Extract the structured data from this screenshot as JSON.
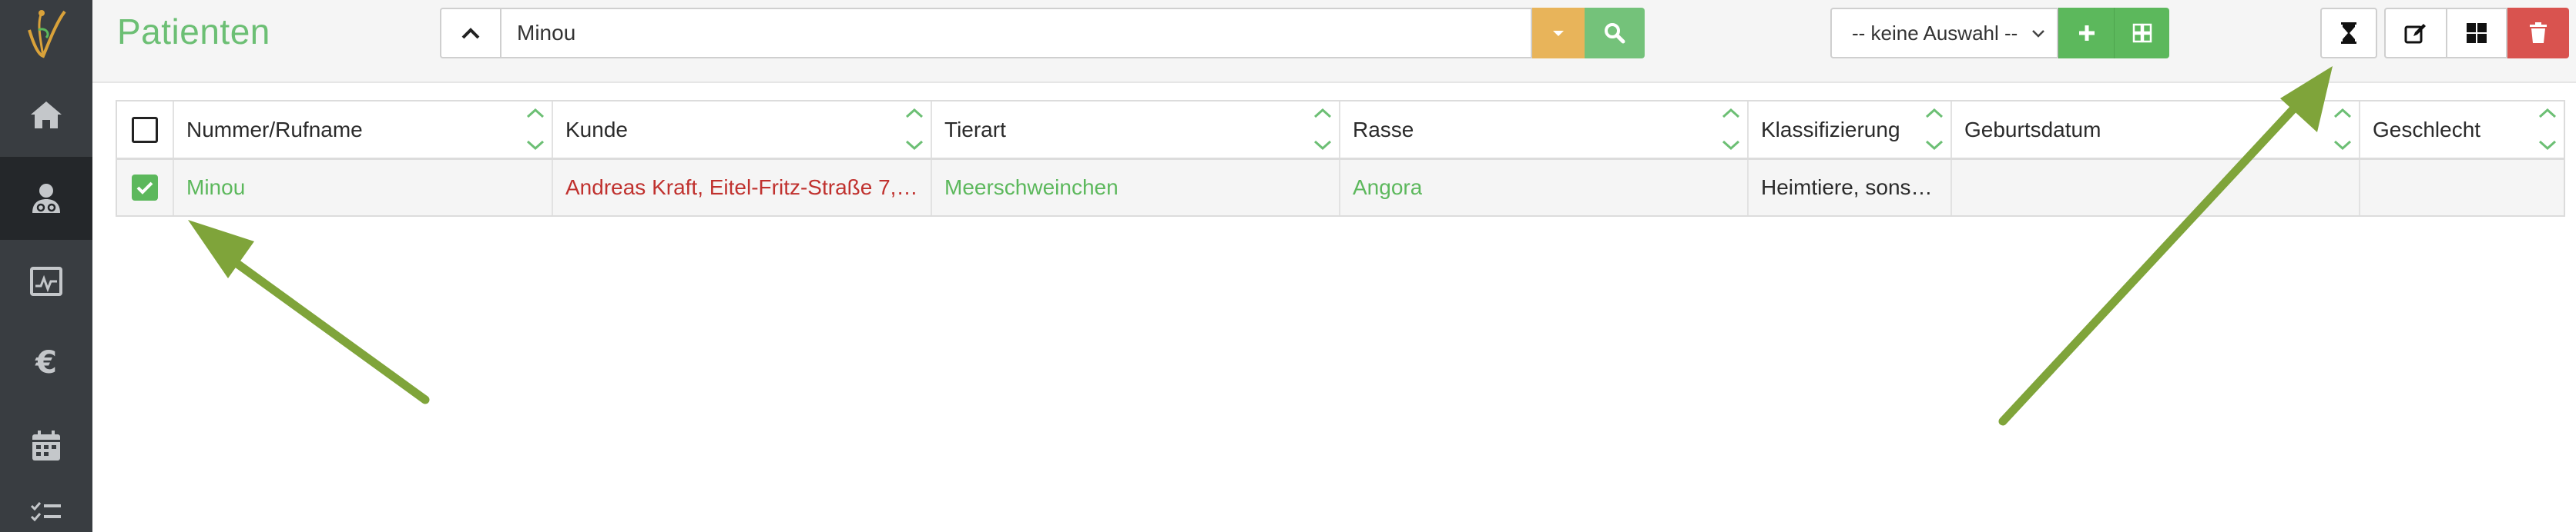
{
  "header": {
    "title": "Patienten",
    "search": {
      "value": "Minou",
      "placeholder": ""
    },
    "select": {
      "value": "-- keine Auswahl --"
    }
  },
  "sidebar": {
    "items": [
      {
        "icon": "home-icon"
      },
      {
        "icon": "patient-icon",
        "active": true
      },
      {
        "icon": "chart-icon"
      },
      {
        "icon": "euro-icon"
      },
      {
        "icon": "calendar-icon"
      },
      {
        "icon": "tasks-icon"
      }
    ]
  },
  "table": {
    "columns": [
      "Nummer/Rufname",
      "Kunde",
      "Tierart",
      "Rasse",
      "Klassifizierung",
      "Geburtsdatum",
      "Geschlecht"
    ],
    "rows": [
      {
        "checked": true,
        "name": "Minou",
        "kunde": "Andreas Kraft, Eitel-Fritz-Straße 7, …",
        "tierart": "Meerschweinchen",
        "rasse": "Angora",
        "klassifizierung": "Heimtiere, sonsti…",
        "geburtsdatum": "",
        "geschlecht": ""
      }
    ]
  },
  "colors": {
    "sidebar": "#393d41",
    "accent_green": "#5cb85c",
    "title_green": "#6cbf74",
    "warning": "#e8b45a",
    "danger": "#d9534f",
    "customer_red": "#c0312e",
    "annotation_arrow": "#7fa43a"
  }
}
